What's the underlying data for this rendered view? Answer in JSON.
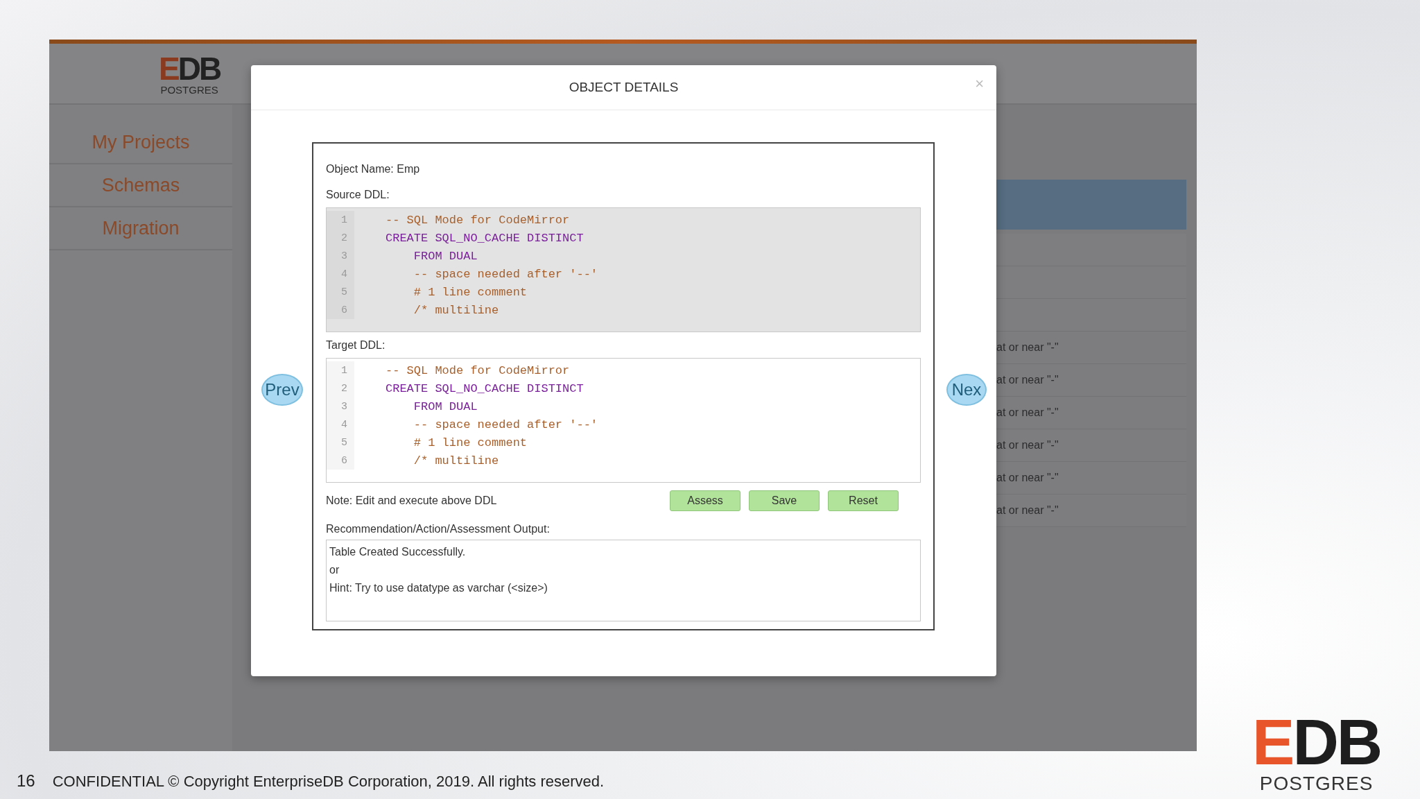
{
  "app": {
    "logo": {
      "mark": "EDB",
      "sub": "POSTGRES"
    },
    "sidebar": {
      "items": [
        {
          "label": "My Projects"
        },
        {
          "label": "Schemas"
        },
        {
          "label": "Migration"
        }
      ]
    },
    "background_rows": [
      {
        "kind": "highlight"
      },
      {
        "kind": "blank"
      },
      {
        "kind": "blank"
      },
      {
        "kind": "blank"
      },
      {
        "kind": "message",
        "text": "at or near \"-\""
      },
      {
        "kind": "message",
        "text": "at or near \"-\""
      },
      {
        "kind": "message",
        "text": "at or near \"-\""
      },
      {
        "kind": "message",
        "text": "at or near \"-\""
      },
      {
        "kind": "message",
        "text": "at or near \"-\""
      },
      {
        "kind": "message",
        "text": "at or near \"-\""
      }
    ]
  },
  "modal": {
    "title": "OBJECT DETAILS",
    "close": "×",
    "prev": "Prev",
    "next": "Nex",
    "object_name": "Object Name: Emp",
    "source": {
      "label": "Source DDL:",
      "readonly": true,
      "lines": [
        {
          "num": "1",
          "kind": "comment",
          "text": "-- SQL Mode for CodeMirror"
        },
        {
          "num": "2",
          "kind": "keyword",
          "text": "CREATE SQL_NO_CACHE DISTINCT"
        },
        {
          "num": "3",
          "kind": "keyword",
          "text": "    FROM DUAL"
        },
        {
          "num": "4",
          "kind": "comment",
          "text": "    -- space needed after '--'"
        },
        {
          "num": "5",
          "kind": "comment",
          "text": "    # 1 line comment"
        },
        {
          "num": "6",
          "kind": "comment",
          "text": "    /* multiline"
        }
      ]
    },
    "target": {
      "label": "Target DDL:",
      "readonly": false,
      "lines": [
        {
          "num": "1",
          "kind": "comment",
          "text": "-- SQL Mode for CodeMirror"
        },
        {
          "num": "2",
          "kind": "keyword",
          "text": "CREATE SQL_NO_CACHE DISTINCT"
        },
        {
          "num": "3",
          "kind": "keyword",
          "text": "    FROM DUAL"
        },
        {
          "num": "4",
          "kind": "comment",
          "text": "    -- space needed after '--'"
        },
        {
          "num": "5",
          "kind": "comment",
          "text": "    # 1 line comment"
        },
        {
          "num": "6",
          "kind": "comment",
          "text": "    /* multiline"
        }
      ]
    },
    "note": "Note: Edit and execute above DDL",
    "buttons": [
      "Assess",
      "Save",
      "Reset"
    ],
    "output": {
      "label": "Recommendation/Action/Assessment Output:",
      "lines": [
        "Table Created Successfully.",
        "or",
        "Hint: Try to use datatype as varchar (<size>)"
      ]
    }
  },
  "footer": {
    "page": "16",
    "text": "CONFIDENTIAL © Copyright EnterpriseDB Corporation, 2019. All rights reserved.",
    "logo": {
      "mark": "EDB",
      "sub": "POSTGRES"
    }
  }
}
